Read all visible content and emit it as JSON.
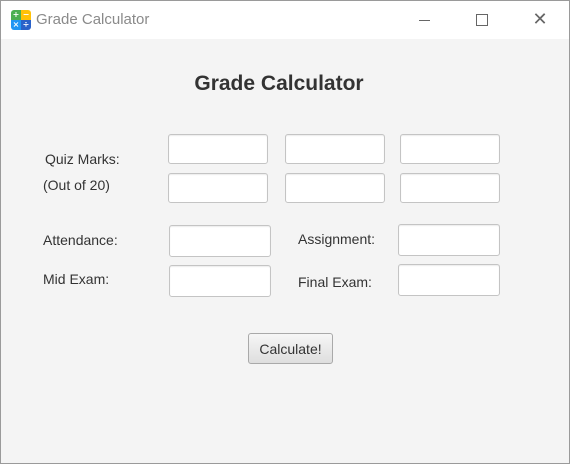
{
  "window": {
    "title": "Grade Calculator",
    "icon": "calculator-app-icon",
    "controls": [
      "minimize-icon",
      "maximize-icon",
      "close-icon"
    ]
  },
  "form": {
    "heading": "Grade Calculator",
    "quiz": {
      "label_line1": "Quiz Marks:",
      "label_line2": "(Out of 20)",
      "values": [
        "",
        "",
        "",
        "",
        "",
        ""
      ]
    },
    "attendance": {
      "label": "Attendance:",
      "value": ""
    },
    "assignment": {
      "label": "Assignment:",
      "value": ""
    },
    "mid_exam": {
      "label": "Mid Exam:",
      "value": ""
    },
    "final_exam": {
      "label": "Final Exam:",
      "value": ""
    },
    "calculate_label": "Calculate!"
  },
  "colors": {
    "background": "#f4f4f4",
    "titlebar": "#ffffff",
    "text": "#333333",
    "field_border": "#c4c4c4"
  }
}
